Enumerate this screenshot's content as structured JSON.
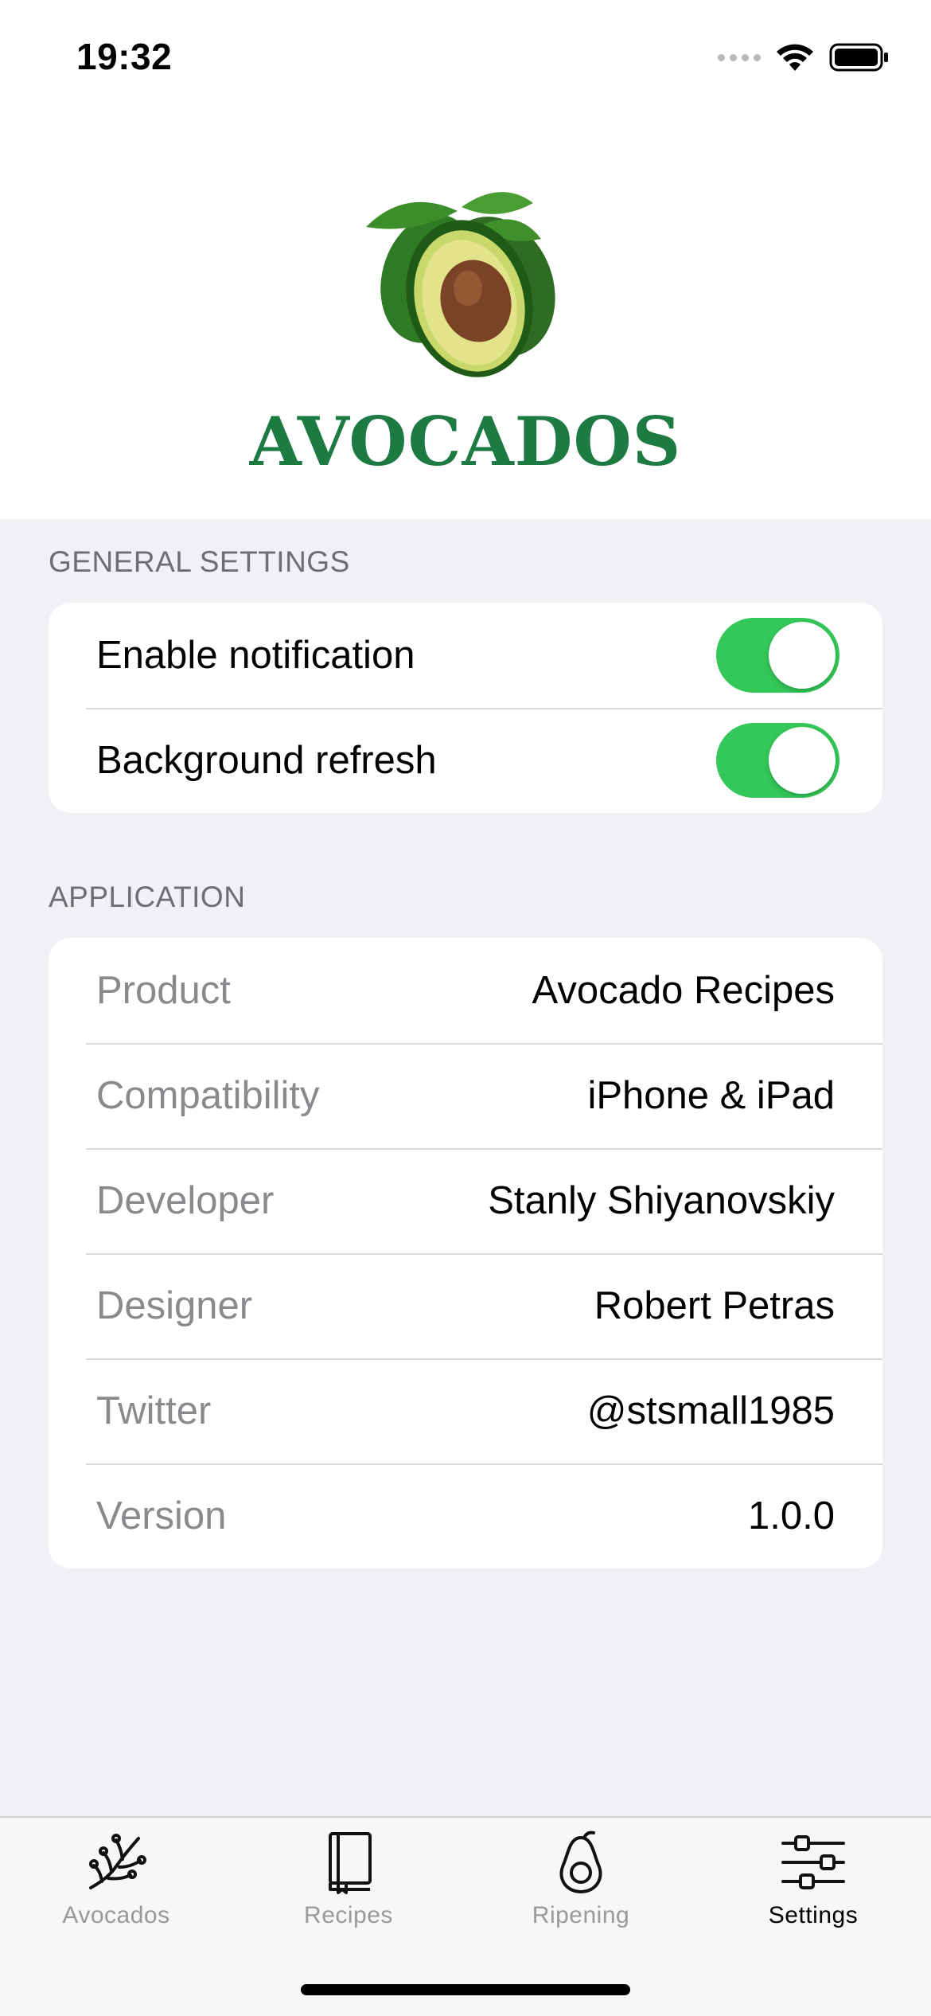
{
  "status_bar": {
    "time": "19:32"
  },
  "header": {
    "title": "AVOCADOS",
    "brand_color": "#1d7a43",
    "logo_icon": "avocado-logo"
  },
  "sections": {
    "general": {
      "header": "GENERAL SETTINGS",
      "rows": [
        {
          "label": "Enable notification",
          "toggle_on": true
        },
        {
          "label": "Background refresh",
          "toggle_on": true
        }
      ]
    },
    "application": {
      "header": "APPLICATION",
      "rows": [
        {
          "label": "Product",
          "value": "Avocado Recipes"
        },
        {
          "label": "Compatibility",
          "value": "iPhone & iPad"
        },
        {
          "label": "Developer",
          "value": "Stanly Shiyanovskiy"
        },
        {
          "label": "Designer",
          "value": "Robert Petras"
        },
        {
          "label": "Twitter",
          "value": "@stsmall1985"
        },
        {
          "label": "Version",
          "value": "1.0.0"
        }
      ]
    }
  },
  "tab_bar": {
    "tabs": [
      {
        "label": "Avocados",
        "icon": "branch-icon",
        "active": false
      },
      {
        "label": "Recipes",
        "icon": "book-icon",
        "active": false
      },
      {
        "label": "Ripening",
        "icon": "avocado-icon",
        "active": false
      },
      {
        "label": "Settings",
        "icon": "sliders-icon",
        "active": true
      }
    ]
  },
  "colors": {
    "toggle_on": "#34c759",
    "background": "#f0f0f5",
    "secondary_text": "#8a8a8e"
  }
}
